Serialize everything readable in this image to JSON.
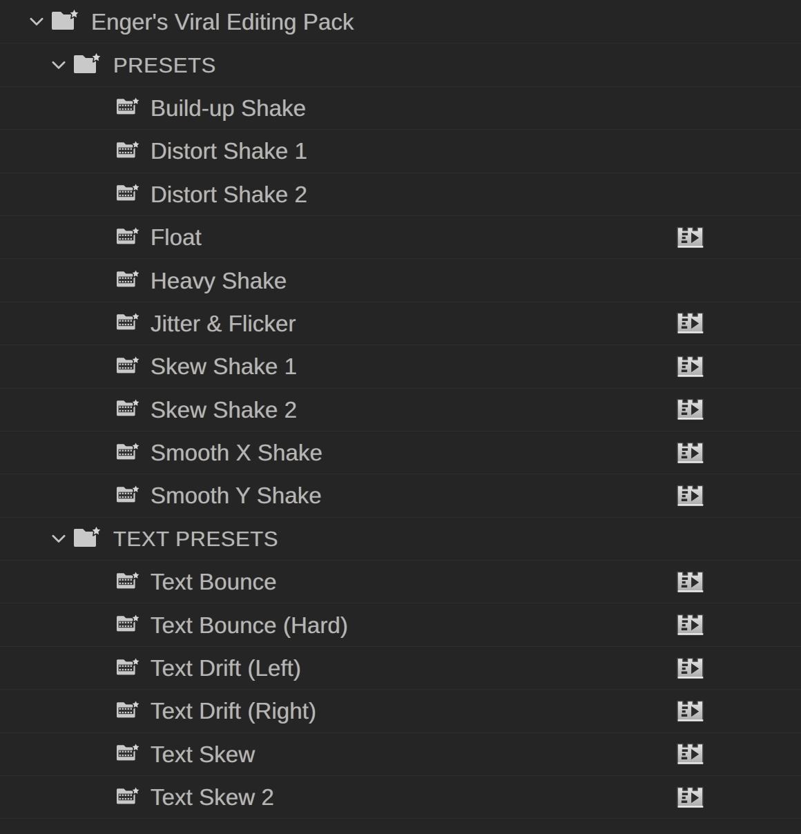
{
  "panel": {
    "name": "effect-presets-tree",
    "background_color": "#252525",
    "row_separator_color": "#2e2e2e",
    "label_color": "#b6b6b6",
    "icon_color": "#c8c8c8"
  },
  "tree": {
    "root": {
      "label": "Enger's Viral Editing Pack",
      "level": 0,
      "expanded": true,
      "icon": "folder-star-icon",
      "chevron": "chevron-down-icon",
      "has_preview": false
    },
    "groups": [
      {
        "label": "PRESETS",
        "level": 1,
        "expanded": true,
        "icon": "folder-star-icon",
        "chevron": "chevron-down-icon",
        "has_preview": false,
        "items": [
          {
            "label": "Build-up Shake",
            "icon": "preset-folder-star-icon",
            "has_preview": false,
            "preview_icon": "preview-play-icon"
          },
          {
            "label": "Distort Shake 1",
            "icon": "preset-folder-star-icon",
            "has_preview": false,
            "preview_icon": "preview-play-icon"
          },
          {
            "label": "Distort Shake 2",
            "icon": "preset-folder-star-icon",
            "has_preview": false,
            "preview_icon": "preview-play-icon"
          },
          {
            "label": "Float",
            "icon": "preset-folder-star-icon",
            "has_preview": true,
            "preview_icon": "preview-play-icon"
          },
          {
            "label": "Heavy Shake",
            "icon": "preset-folder-star-icon",
            "has_preview": false,
            "preview_icon": "preview-play-icon"
          },
          {
            "label": "Jitter & Flicker",
            "icon": "preset-folder-star-icon",
            "has_preview": true,
            "preview_icon": "preview-play-icon"
          },
          {
            "label": "Skew Shake 1",
            "icon": "preset-folder-star-icon",
            "has_preview": true,
            "preview_icon": "preview-play-icon"
          },
          {
            "label": "Skew Shake 2",
            "icon": "preset-folder-star-icon",
            "has_preview": true,
            "preview_icon": "preview-play-icon"
          },
          {
            "label": "Smooth X Shake",
            "icon": "preset-folder-star-icon",
            "has_preview": true,
            "preview_icon": "preview-play-icon"
          },
          {
            "label": "Smooth Y Shake",
            "icon": "preset-folder-star-icon",
            "has_preview": true,
            "preview_icon": "preview-play-icon"
          }
        ]
      },
      {
        "label": "TEXT PRESETS",
        "level": 1,
        "expanded": true,
        "icon": "folder-star-icon",
        "chevron": "chevron-down-icon",
        "has_preview": false,
        "items": [
          {
            "label": "Text Bounce",
            "icon": "preset-folder-star-icon",
            "has_preview": true,
            "preview_icon": "preview-play-icon"
          },
          {
            "label": "Text Bounce (Hard)",
            "icon": "preset-folder-star-icon",
            "has_preview": true,
            "preview_icon": "preview-play-icon"
          },
          {
            "label": "Text Drift (Left)",
            "icon": "preset-folder-star-icon",
            "has_preview": true,
            "preview_icon": "preview-play-icon"
          },
          {
            "label": "Text Drift (Right)",
            "icon": "preset-folder-star-icon",
            "has_preview": true,
            "preview_icon": "preview-play-icon"
          },
          {
            "label": "Text Skew",
            "icon": "preset-folder-star-icon",
            "has_preview": true,
            "preview_icon": "preview-play-icon"
          },
          {
            "label": "Text Skew 2",
            "icon": "preset-folder-star-icon",
            "has_preview": true,
            "preview_icon": "preview-play-icon"
          }
        ]
      }
    ]
  }
}
